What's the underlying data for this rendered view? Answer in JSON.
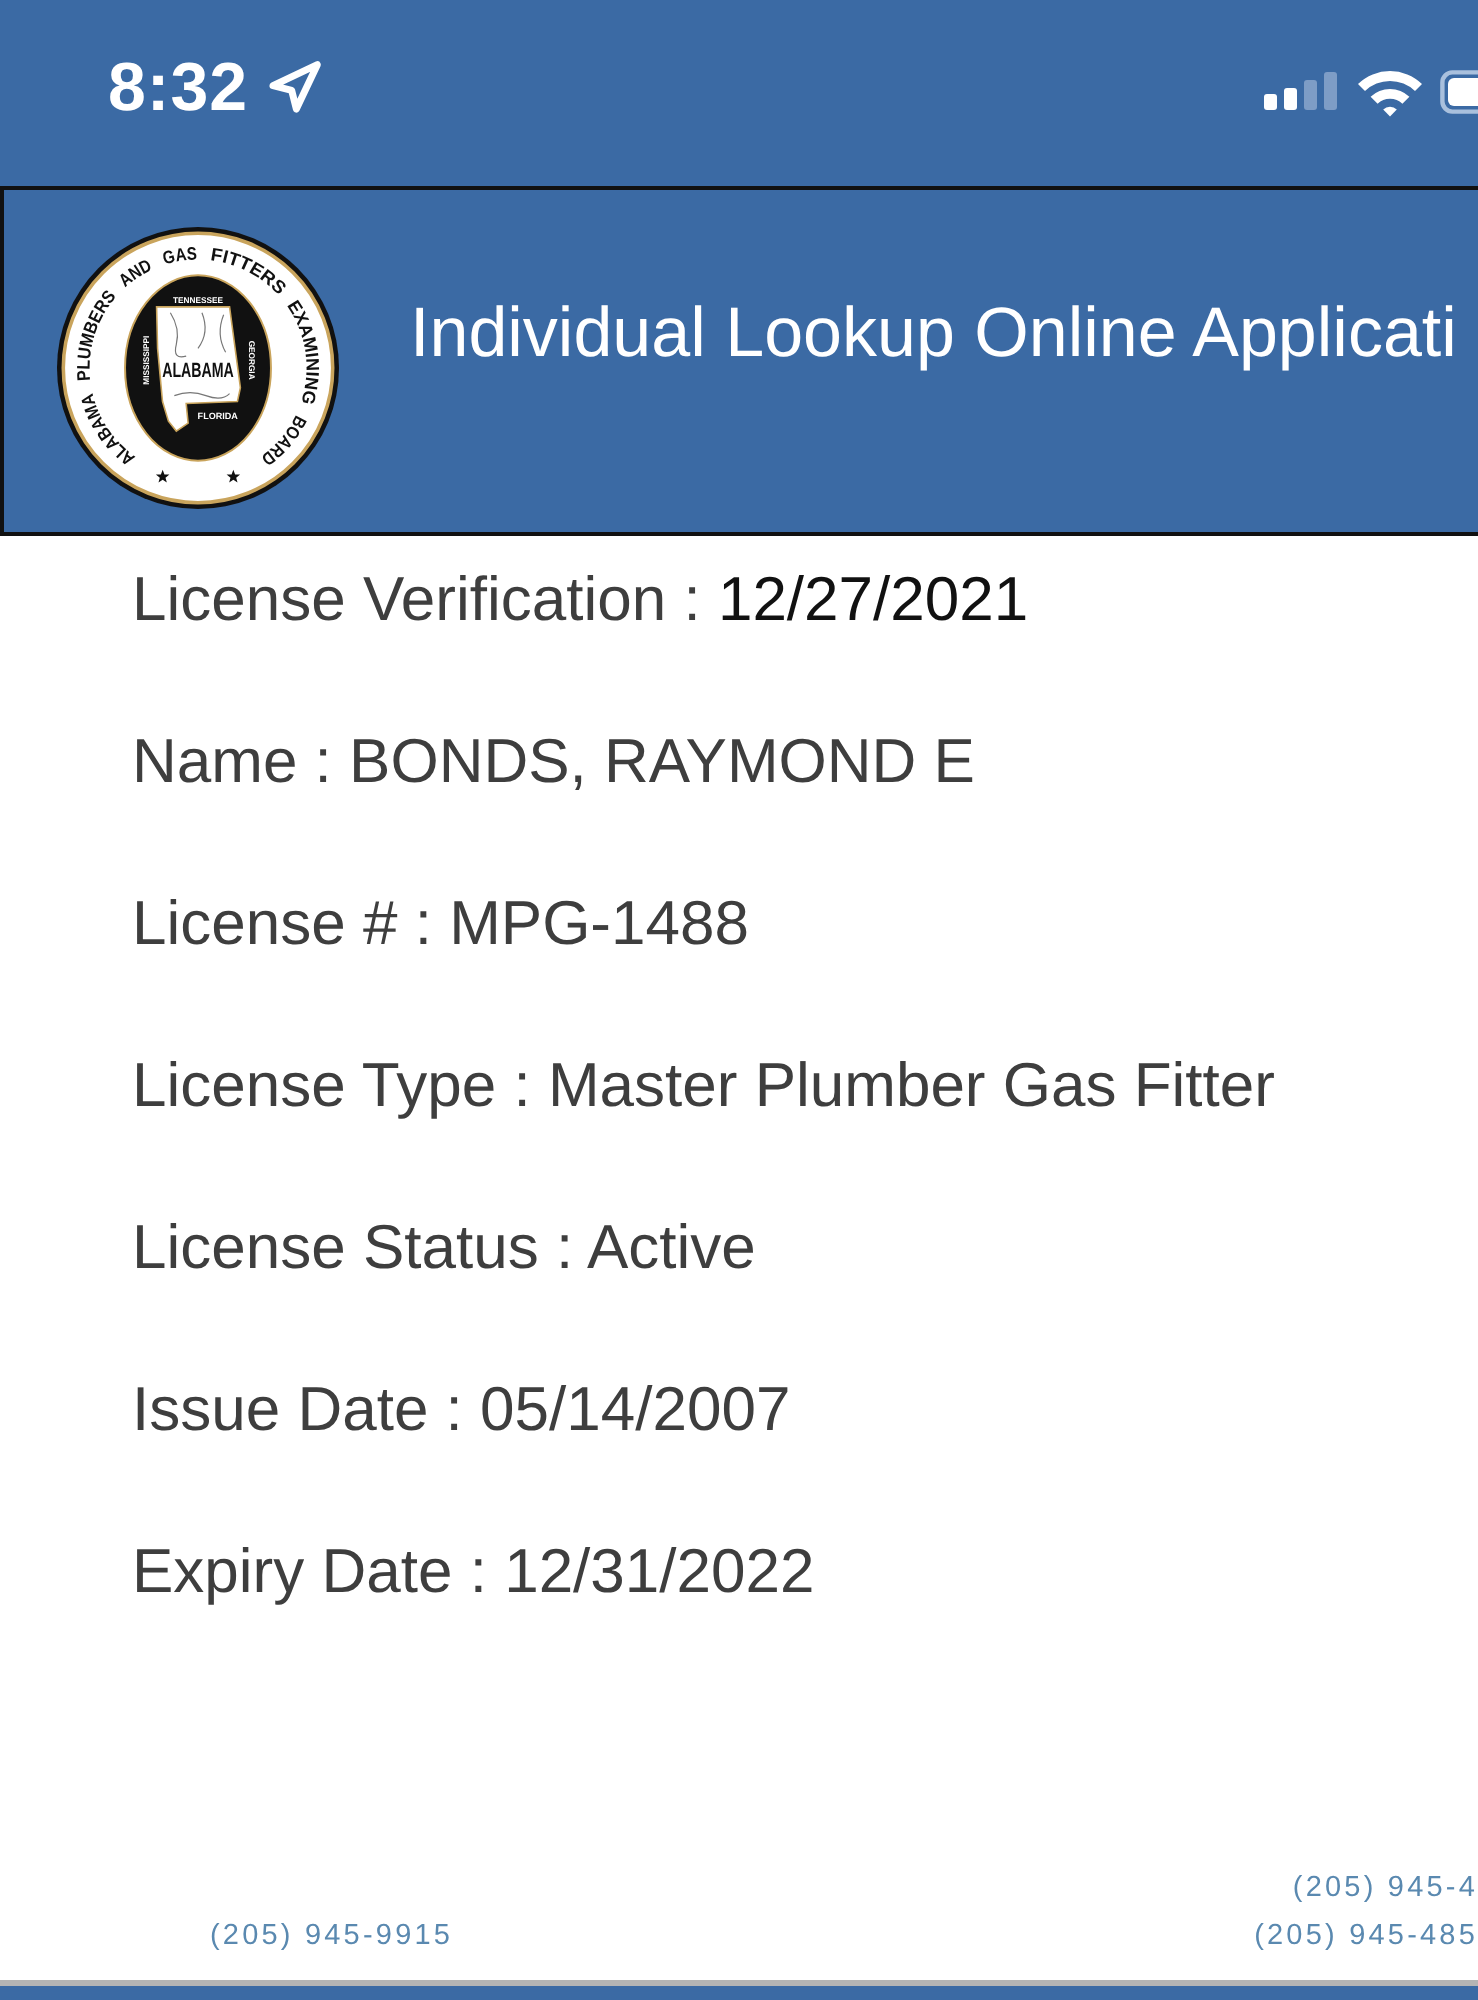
{
  "status_bar": {
    "time": "8:32"
  },
  "header": {
    "title": "Individual Lookup Online Applicati",
    "seal": {
      "ring_text": "ALABAMA PLUMBERS AND GAS FITTERS EXAMINING BOARD",
      "center_text": "ALABAMA",
      "neighbors": {
        "top": "TENNESSEE",
        "left": "MISSISSIPPI",
        "right": "GEORGIA",
        "bottom": "FLORIDA"
      }
    }
  },
  "verification": {
    "label": "License Verification :",
    "date": "12/27/2021"
  },
  "fields": [
    {
      "label": "Name :",
      "value": "BONDS, RAYMOND E"
    },
    {
      "label": "License # :",
      "value": "MPG-1488"
    },
    {
      "label": "License Type :",
      "value": "Master Plumber Gas Fitter"
    },
    {
      "label": "License Status :",
      "value": "Active"
    },
    {
      "label": "Issue Date :",
      "value": "05/14/2007"
    },
    {
      "label": "Expiry Date :",
      "value": "12/31/2022"
    }
  ],
  "footer": {
    "phones_left": [
      "(205) 945-9915"
    ],
    "phones_right": [
      "(205) 945-4",
      "(205) 945-485"
    ]
  }
}
